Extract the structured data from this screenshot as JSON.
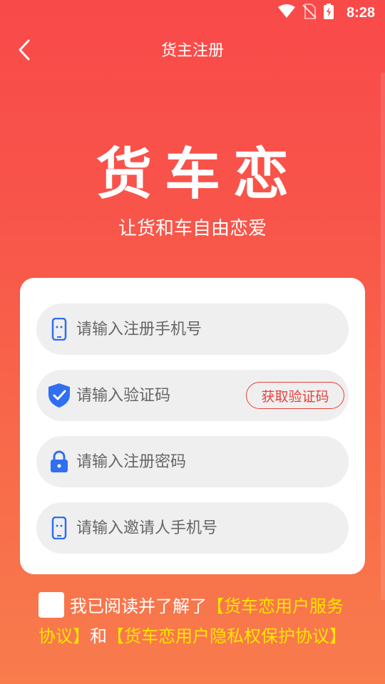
{
  "status_bar": {
    "time": "8:28"
  },
  "header": {
    "title": "货主注册"
  },
  "brand": {
    "name": "货车恋",
    "slogan": "让货和车自由恋爱"
  },
  "form": {
    "phone_placeholder": "请输入注册手机号",
    "code_placeholder": "请输入验证码",
    "get_code_label": "获取验证码",
    "password_placeholder": "请输入注册密码",
    "inviter_placeholder": "请输入邀请人手机号"
  },
  "agreement": {
    "prefix": "我已阅读并了解了",
    "user_agreement": "【货车恋用户服务协议】",
    "connector": "和",
    "privacy_agreement": "【货车恋用户隐私权保护协议】"
  },
  "colors": {
    "accent": "#e8413b",
    "link": "#ffe600",
    "icon_blue": "#2f6ff0"
  }
}
